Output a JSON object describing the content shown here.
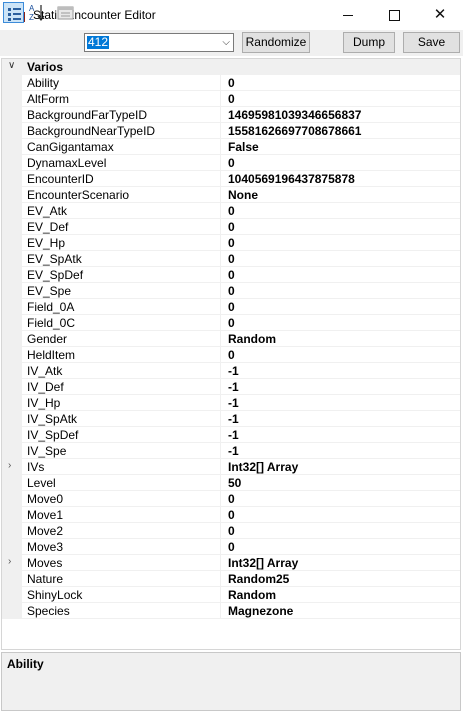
{
  "window": {
    "title": "Static Encounter Editor",
    "minimize_glyph": "",
    "maximize_glyph": "",
    "close_glyph": "✕"
  },
  "toolbar": {
    "categorized_icon": "categorized-icon",
    "alphabetical_icon": "sort-alphabetical-icon",
    "property_pages_icon": "property-pages-icon",
    "combo_value": "412",
    "randomize_label": "Randomize",
    "dump_label": "Dump",
    "save_label": "Save"
  },
  "grid": {
    "category": "Varios",
    "properties": [
      {
        "name": "Ability",
        "value": "0",
        "expandable": false
      },
      {
        "name": "AltForm",
        "value": "0",
        "expandable": false
      },
      {
        "name": "BackgroundFarTypeID",
        "value": "14695981039346656837",
        "expandable": false
      },
      {
        "name": "BackgroundNearTypeID",
        "value": "15581626697708678661",
        "expandable": false
      },
      {
        "name": "CanGigantamax",
        "value": "False",
        "expandable": false
      },
      {
        "name": "DynamaxLevel",
        "value": "0",
        "expandable": false
      },
      {
        "name": "EncounterID",
        "value": "1040569196437875878",
        "expandable": false
      },
      {
        "name": "EncounterScenario",
        "value": "None",
        "expandable": false
      },
      {
        "name": "EV_Atk",
        "value": "0",
        "expandable": false
      },
      {
        "name": "EV_Def",
        "value": "0",
        "expandable": false
      },
      {
        "name": "EV_Hp",
        "value": "0",
        "expandable": false
      },
      {
        "name": "EV_SpAtk",
        "value": "0",
        "expandable": false
      },
      {
        "name": "EV_SpDef",
        "value": "0",
        "expandable": false
      },
      {
        "name": "EV_Spe",
        "value": "0",
        "expandable": false
      },
      {
        "name": "Field_0A",
        "value": "0",
        "expandable": false
      },
      {
        "name": "Field_0C",
        "value": "0",
        "expandable": false
      },
      {
        "name": "Gender",
        "value": "Random",
        "expandable": false
      },
      {
        "name": "HeldItem",
        "value": "0",
        "expandable": false
      },
      {
        "name": "IV_Atk",
        "value": "-1",
        "expandable": false
      },
      {
        "name": "IV_Def",
        "value": "-1",
        "expandable": false
      },
      {
        "name": "IV_Hp",
        "value": "-1",
        "expandable": false
      },
      {
        "name": "IV_SpAtk",
        "value": "-1",
        "expandable": false
      },
      {
        "name": "IV_SpDef",
        "value": "-1",
        "expandable": false
      },
      {
        "name": "IV_Spe",
        "value": "-1",
        "expandable": false
      },
      {
        "name": "IVs",
        "value": "Int32[] Array",
        "expandable": true
      },
      {
        "name": "Level",
        "value": "50",
        "expandable": false
      },
      {
        "name": "Move0",
        "value": "0",
        "expandable": false
      },
      {
        "name": "Move1",
        "value": "0",
        "expandable": false
      },
      {
        "name": "Move2",
        "value": "0",
        "expandable": false
      },
      {
        "name": "Move3",
        "value": "0",
        "expandable": false
      },
      {
        "name": "Moves",
        "value": "Int32[] Array",
        "expandable": true
      },
      {
        "name": "Nature",
        "value": "Random25",
        "expandable": false
      },
      {
        "name": "ShinyLock",
        "value": "Random",
        "expandable": false
      },
      {
        "name": "Species",
        "value": "Magnezone",
        "expandable": false
      }
    ]
  },
  "help": {
    "title": "Ability"
  },
  "colors": {
    "selection": "#0078d7",
    "grid_margin": "#f0f0f0",
    "window_bg": "#f0f0f0"
  }
}
